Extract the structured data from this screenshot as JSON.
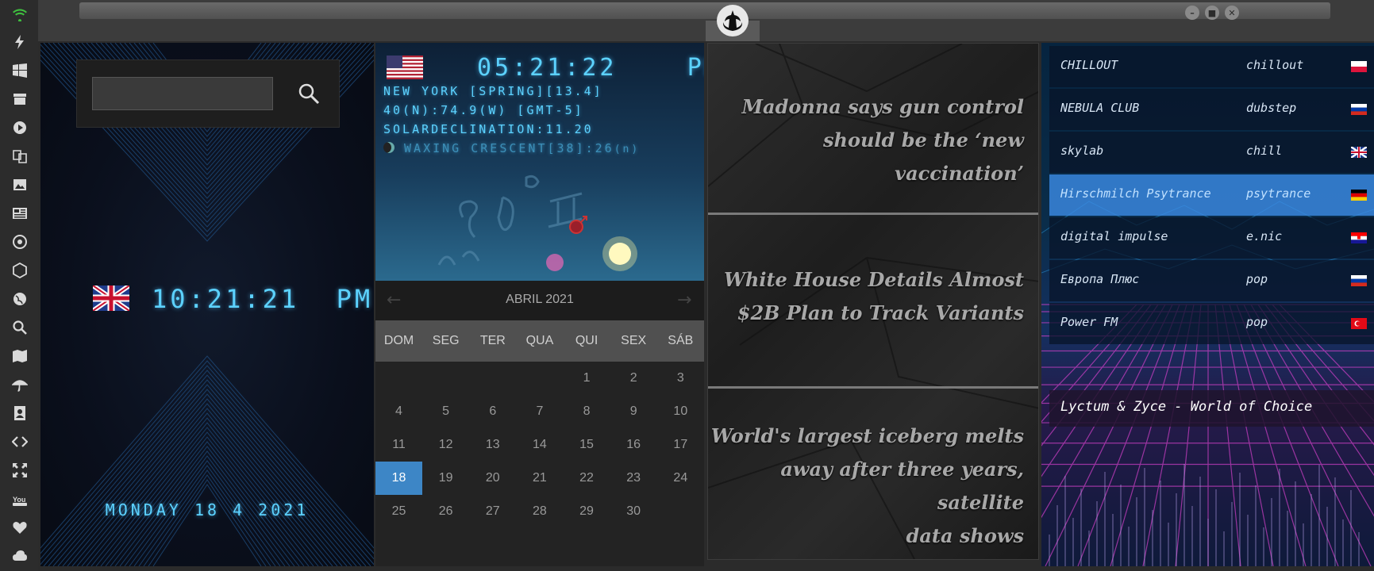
{
  "rail_icons": [
    "wifi-icon",
    "bolt-icon",
    "windows-icon",
    "archive-icon",
    "play-icon",
    "translate-icon",
    "image-icon",
    "news-icon",
    "aperture-icon",
    "hexagon-icon",
    "globe-icon",
    "search-icon",
    "map-icon",
    "umbrella-icon",
    "contacts-icon",
    "code-icon",
    "expand-icon",
    "youtube-icon",
    "heart-icon",
    "cloud-icon"
  ],
  "panel_clock": {
    "search_placeholder": "",
    "time": "10:21:21",
    "ampm": "PM",
    "date": "MONDAY 18 4 2021",
    "flag": "uk-flag"
  },
  "panel_astro": {
    "time": "05:21:22",
    "ampm": "PM",
    "flag": "us-flag",
    "line1": "NEW YORK [SPRING][13.4]",
    "line2": "40(N):74.9(W) [GMT-5]",
    "line3": "SOLARDECLINATION:11.20",
    "line4": "WAXING CRESCENT[38]:26",
    "line4_suffix": "(n)"
  },
  "calendar": {
    "month": "ABRIL 2021",
    "days": [
      "DOM",
      "SEG",
      "TER",
      "QUA",
      "QUI",
      "SEX",
      "SÁB"
    ],
    "first_weekday": 4,
    "num_days": 30,
    "today": 18,
    "accent": "#3d86c6"
  },
  "news": {
    "headlines": [
      [
        "Madonna says gun control",
        "should be the ‘new vaccination’"
      ],
      [
        "White House Details Almost",
        "$2B Plan to Track Variants"
      ],
      [
        "World's largest iceberg melts",
        "away after three years, satellite",
        "data shows"
      ]
    ]
  },
  "radio": {
    "stations": [
      {
        "name": "CHILLOUT",
        "genre": "chillout",
        "flag": "poland-flag"
      },
      {
        "name": "NEBULA CLUB",
        "genre": "dubstep",
        "flag": "russia-flag"
      },
      {
        "name": "skylab",
        "genre": "chill",
        "flag": "uk-flag"
      },
      {
        "name": "Hirschmilch Psytrance",
        "genre": "psytrance",
        "flag": "germany-flag",
        "active": true
      },
      {
        "name": "digital impulse",
        "genre": "e.nic",
        "flag": "croatia-flag"
      },
      {
        "name": "Европа Плюс",
        "genre": "pop",
        "flag": "russia-flag"
      },
      {
        "name": "Power FM",
        "genre": "pop",
        "flag": "turkey-flag"
      }
    ],
    "now_playing": "Lyctum & Zyce - World of Choice"
  },
  "window_buttons": [
    "minimize",
    "maximize",
    "close"
  ]
}
